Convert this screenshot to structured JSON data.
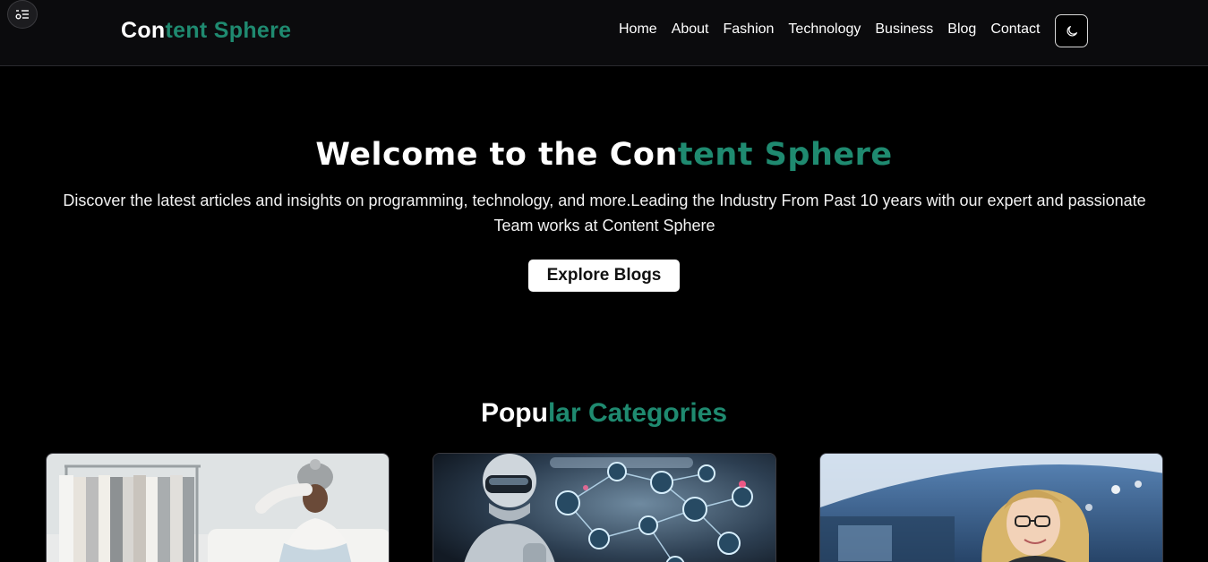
{
  "brand": {
    "part1": "Con",
    "part2": "tent Sphere"
  },
  "nav": {
    "links": [
      "Home",
      "About",
      "Fashion",
      "Technology",
      "Business",
      "Blog",
      "Contact"
    ]
  },
  "icons": {
    "menu": "menu-toggle-icon",
    "theme": "moon-icon"
  },
  "hero": {
    "title_part1": "Welcome to the Con",
    "title_part2": "tent Sphere",
    "description": "Discover the latest articles and insights on programming, technology, and more.Leading the Industry From Past 10 years with our expert and passionate Team works at Content Sphere",
    "button_label": "Explore Blogs"
  },
  "categories": {
    "title_part1": "Popu",
    "title_part2": "lar Categories",
    "cards": [
      "fashion-image",
      "technology-image",
      "business-image"
    ]
  },
  "colors": {
    "accent": "#1f8a70",
    "background": "#000000",
    "navbar": "#0b0b0d"
  }
}
